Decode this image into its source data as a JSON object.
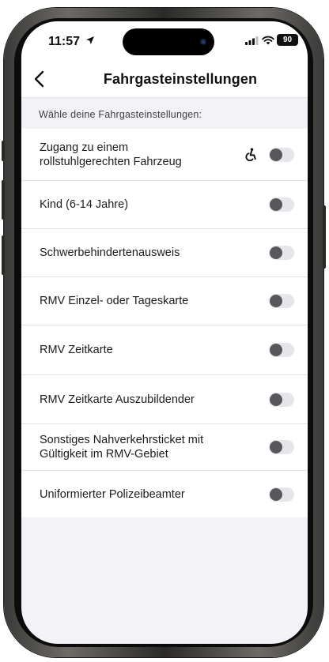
{
  "status_bar": {
    "time": "11:57",
    "battery": "90"
  },
  "nav": {
    "title": "Fahrgasteinstellungen",
    "back_icon": "chevron-left-icon"
  },
  "section": {
    "header": "Wähle deine Fahrgasteinstellungen:"
  },
  "options": [
    {
      "label": "Zugang zu einem\nrollstuhlgerechten Fahrzeug",
      "enabled": false,
      "icon": "wheelchair-icon"
    },
    {
      "label": "Kind (6-14 Jahre)",
      "enabled": false
    },
    {
      "label": "Schwerbehindertenausweis",
      "enabled": false
    },
    {
      "label": "RMV Einzel- oder Tageskarte",
      "enabled": false
    },
    {
      "label": "RMV Zeitkarte",
      "enabled": false
    },
    {
      "label": "RMV Zeitkarte Auszubildender",
      "enabled": false
    },
    {
      "label": "Sonstiges Nahverkehrsticket mit\nGültigkeit im RMV-Gebiet",
      "enabled": false
    },
    {
      "label": "Uniformierter Polizeibeamter",
      "enabled": false
    }
  ],
  "colors": {
    "screen_background": "#f2f2f7",
    "toggle_off_track": "#e5e5ea",
    "toggle_knob": "#57575c"
  }
}
